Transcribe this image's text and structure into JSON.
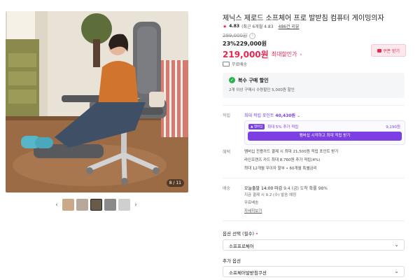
{
  "product": {
    "title": "제닉스 제로드 소프체어 프로 발받침 컴퓨터 게이밍의자",
    "rating": "4.83",
    "rating_note": "(최근 6개월 4.83",
    "review_count": "486건 리뷰",
    "original_price": "299,000원",
    "discount": "23%229,000원",
    "max_discount_price": "219,000원",
    "max_discount_label": "최대할인가",
    "coupon_label": "쿠폰 받기",
    "shipping": "무료배송"
  },
  "gallery": {
    "counter": "8 / 11",
    "thumb_colors": [
      "#c9a98a",
      "#b8a79a",
      "#6a5a48",
      "#8a8a8a",
      "#cfcfcf"
    ],
    "selected_index": 2
  },
  "promo": {
    "heading": "복수 구매 할인",
    "detail": "2개 이상 구매시 수량할인 5,000원 할인"
  },
  "points": {
    "label": "적립",
    "max_text": "최대 적립 포인트",
    "max_value": "40,430원",
    "badge": "▲ 멤버십",
    "line": "최대 5% 추가 적립",
    "amount": "9,190원",
    "button": "멤버십 시작하고 최대 적립 받기"
  },
  "benefits": {
    "label": "혜택",
    "items": [
      "멤버십 전용카드 결제 시 최대 21,500원 적립 포인트 받기",
      "라인프렌즈 카드 최대 8,760원 추가 적립(4%)",
      "최대 12개월 무이자 할부 • 60개월 특별금리"
    ]
  },
  "delivery": {
    "label": "배송",
    "line1_main": "오늘출발 14:00 마감",
    "line1_sub": "9.4 (금) 도착 확률 98%",
    "line2": "지금 결제 시 9.2 (수) 발송 예정",
    "line3": "무료배송",
    "more": "자세히보기"
  },
  "options": {
    "label": "옵션 선택 (필수)",
    "required_mark": "•",
    "selected": "소프프로체어",
    "add_label": "추가 옵션",
    "add_selected": "소프체어발받침쿠션"
  }
}
